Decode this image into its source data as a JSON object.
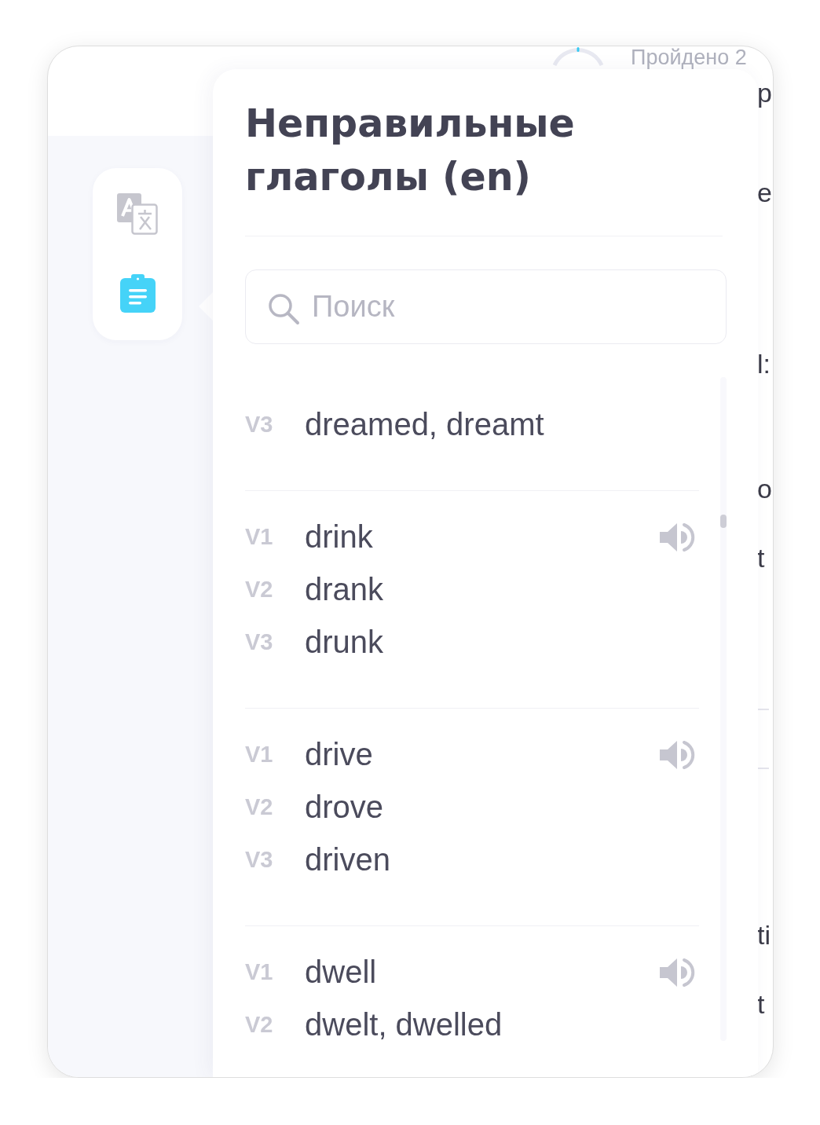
{
  "header": {
    "progress_text": "Пройдено 2"
  },
  "sidebar": {
    "items": [
      {
        "kind": "translate",
        "selected": false
      },
      {
        "kind": "notes",
        "selected": true
      }
    ]
  },
  "panel": {
    "title": "Неправильные глаголы (en)",
    "search": {
      "placeholder": "Поиск"
    },
    "groups": [
      {
        "rows": [
          {
            "label": "V3",
            "text": "dreamed, dreamt",
            "speaker": false
          }
        ]
      },
      {
        "rows": [
          {
            "label": "V1",
            "text": "drink",
            "speaker": true
          },
          {
            "label": "V2",
            "text": "drank",
            "speaker": false
          },
          {
            "label": "V3",
            "text": "drunk",
            "speaker": false
          }
        ]
      },
      {
        "rows": [
          {
            "label": "V1",
            "text": "drive",
            "speaker": true
          },
          {
            "label": "V2",
            "text": "drove",
            "speaker": false
          },
          {
            "label": "V3",
            "text": "driven",
            "speaker": false
          }
        ]
      },
      {
        "rows": [
          {
            "label": "V1",
            "text": "dwell",
            "speaker": true
          },
          {
            "label": "V2",
            "text": "dwelt, dwelled",
            "speaker": false
          }
        ]
      }
    ]
  },
  "background_text": [
    "р",
    "е",
    "l:",
    "о",
    "t",
    "ti",
    "t"
  ]
}
